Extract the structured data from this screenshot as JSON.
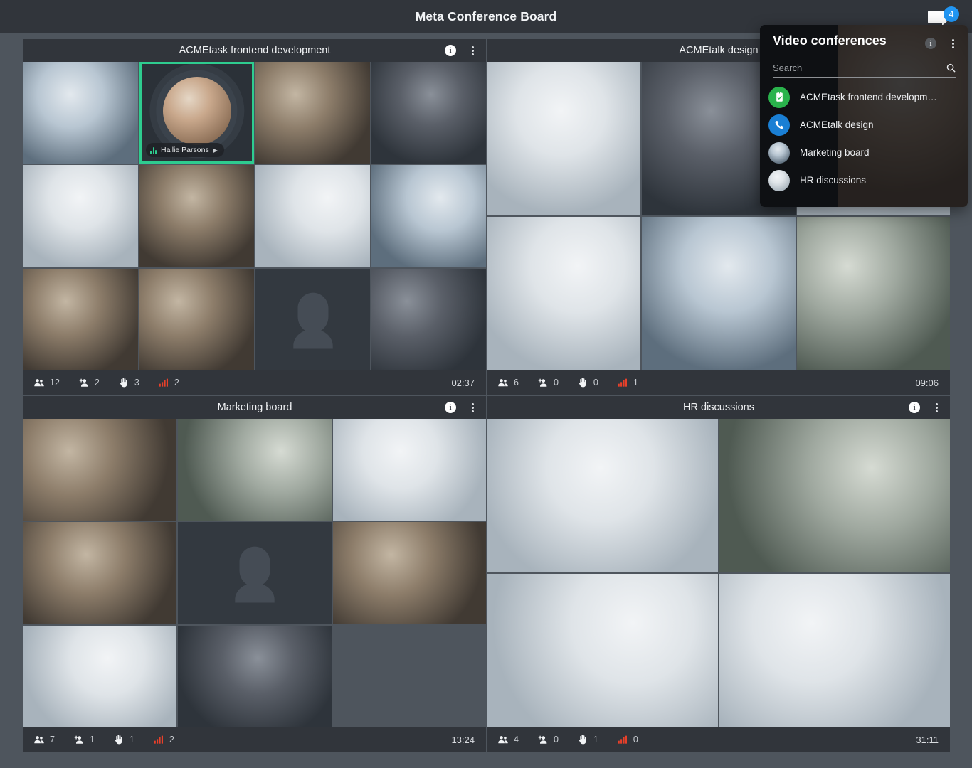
{
  "app": {
    "title": "Meta Conference Board",
    "screen_share_icon": "screen-icon",
    "notification_badge": "4"
  },
  "icons": {
    "info": "i",
    "more": "more-vertical-icon",
    "participants": "people-icon",
    "invited": "person-add-icon",
    "raised_hands": "raised-hand-icon",
    "signal": "signal-bars-icon",
    "search": "search-icon",
    "wave": "audio-wave-icon"
  },
  "colors": {
    "page_bg": "#4e555d",
    "panel_bar": "#31353b",
    "tile_bg": "#333940",
    "active_border": "#2ecc8f",
    "badge_blue": "#2196f3",
    "signal_red": "#e8402a",
    "text_primary": "#f0f2f4",
    "text_muted": "#c8ccd1"
  },
  "panels": [
    {
      "id": "acmetask-frontend-development",
      "title": "ACMEtask frontend development",
      "layout": "grid-4x3",
      "tiles": [
        {
          "kind": "video",
          "style": "t1"
        },
        {
          "kind": "active",
          "style": "t2",
          "name": "Hallie Parsons"
        },
        {
          "kind": "video",
          "style": "t3"
        },
        {
          "kind": "video",
          "style": "t4"
        },
        {
          "kind": "video",
          "style": "t5"
        },
        {
          "kind": "video",
          "style": "t6"
        },
        {
          "kind": "video",
          "style": "t7"
        },
        {
          "kind": "video",
          "style": "t8"
        },
        {
          "kind": "video",
          "style": "t9"
        },
        {
          "kind": "video",
          "style": "t10"
        },
        {
          "kind": "placeholder"
        },
        {
          "kind": "video",
          "style": "t12"
        }
      ],
      "stats": {
        "participants": "12",
        "invited": "2",
        "raised_hands": "3",
        "signal": "2",
        "duration": "02:37"
      }
    },
    {
      "id": "acmetalk-design",
      "title": "ACMEtalk design",
      "layout": "grid-3x2",
      "tiles": [
        {
          "kind": "video",
          "style": "u1"
        },
        {
          "kind": "video",
          "style": "u2"
        },
        {
          "kind": "video",
          "style": "u3"
        },
        {
          "kind": "video",
          "style": "u4"
        },
        {
          "kind": "video",
          "style": "u5"
        },
        {
          "kind": "video",
          "style": "u6"
        }
      ],
      "stats": {
        "participants": "6",
        "invited": "0",
        "raised_hands": "0",
        "signal": "1",
        "duration": "09:06"
      }
    },
    {
      "id": "marketing-board",
      "title": "Marketing board",
      "layout": "grid-3x3",
      "tiles": [
        {
          "kind": "video",
          "style": "m1"
        },
        {
          "kind": "video",
          "style": "m2"
        },
        {
          "kind": "video",
          "style": "m3"
        },
        {
          "kind": "video",
          "style": "m4"
        },
        {
          "kind": "placeholder"
        },
        {
          "kind": "video",
          "style": "m6"
        },
        {
          "kind": "video",
          "style": "m7"
        },
        {
          "kind": "video",
          "style": "m8"
        },
        {
          "kind": "empty"
        }
      ],
      "stats": {
        "participants": "7",
        "invited": "1",
        "raised_hands": "1",
        "signal": "2",
        "duration": "13:24"
      }
    },
    {
      "id": "hr-discussions",
      "title": "HR discussions",
      "layout": "grid-2x2",
      "tiles": [
        {
          "kind": "video",
          "style": "h1"
        },
        {
          "kind": "video",
          "style": "h2"
        },
        {
          "kind": "video",
          "style": "h3"
        },
        {
          "kind": "video",
          "style": "h4"
        }
      ],
      "stats": {
        "participants": "4",
        "invited": "0",
        "raised_hands": "1",
        "signal": "0",
        "duration": "31:11"
      }
    }
  ],
  "dropdown": {
    "title": "Video conferences",
    "search": {
      "placeholder": "Search",
      "value": ""
    },
    "items": [
      {
        "label": "ACMEtask frontend developm…",
        "avatar": "clipboard-check-badge",
        "avatar_color": "#2ab34c"
      },
      {
        "label": "ACMEtalk design",
        "avatar": "phone-badge",
        "avatar_color": "#1a7fd4"
      },
      {
        "label": "Marketing board",
        "avatar": "photo-avatar",
        "avatar_color": "#9fb6c6"
      },
      {
        "label": "HR discussions",
        "avatar": "photo-avatar",
        "avatar_color": "#cdd9e3"
      }
    ]
  }
}
